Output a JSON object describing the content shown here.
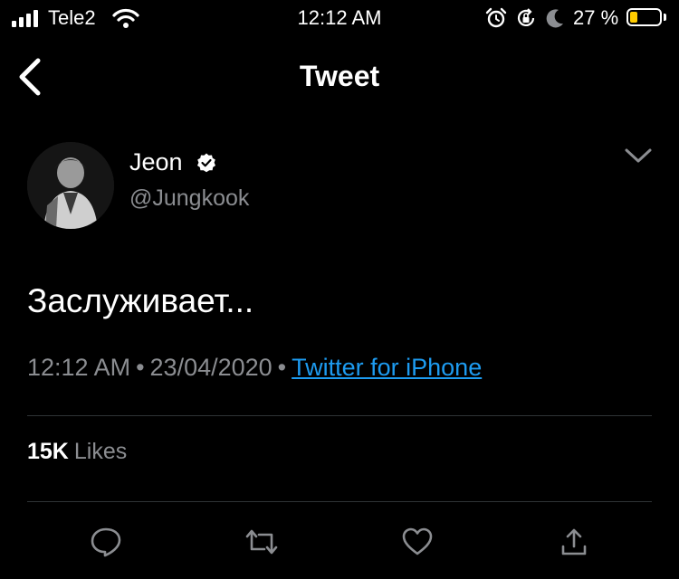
{
  "status_bar": {
    "carrier": "Tele2",
    "time": "12:12 AM",
    "battery_percent": "27 %",
    "battery_level": 0.27,
    "battery_color": "#ffcc00"
  },
  "nav": {
    "title": "Tweet",
    "back_icon": "chevron-left-icon"
  },
  "tweet": {
    "author_name": "Jeon",
    "author_handle": "@Jungkook",
    "verified": true,
    "text": "Заслуживает...",
    "time": "12:12 AM",
    "date": "23/04/2020",
    "source": "Twitter for iPhone",
    "separator": "•",
    "likes_count": "15K",
    "likes_label": "Likes"
  },
  "actions": [
    {
      "name": "reply",
      "icon": "speech-bubble-icon"
    },
    {
      "name": "retweet",
      "icon": "retweet-icon"
    },
    {
      "name": "like",
      "icon": "heart-icon"
    },
    {
      "name": "share",
      "icon": "share-icon"
    }
  ],
  "colors": {
    "background": "#000000",
    "text": "#ffffff",
    "secondary": "#8b8d91",
    "link": "#1d9bf0",
    "divider": "#2f3336"
  }
}
